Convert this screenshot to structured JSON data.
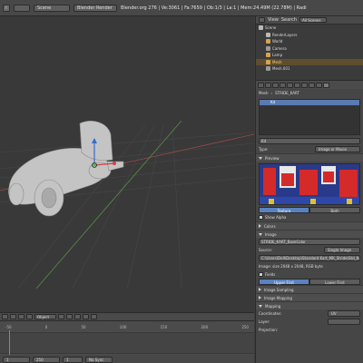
{
  "topbar": {
    "layout": "Scene",
    "render_engine": "Blender Render",
    "stats": "Blender.org 276 | Ve:3061 | Fa:7659 | Ob:1/3 | La:1 | Mem:24.49M (22.78M) | Radi"
  },
  "viewport": {
    "view_name": "",
    "mode": "Object",
    "colors": {
      "grid": "#4a4a4a",
      "axis_x": "#b04a4a",
      "axis_y": "#6aa050",
      "object": "#c9c9c9"
    }
  },
  "timeline": {
    "ruler": [
      "-50",
      "0",
      "50",
      "100",
      "150",
      "200",
      "250"
    ],
    "start": "1",
    "end": "250",
    "current": "1",
    "sync": "No Sync"
  },
  "outliner": {
    "view_label": "View",
    "search_label": "Search",
    "filter": "All Scenes",
    "items": [
      {
        "label": "Scene",
        "indent": 0,
        "color": "#b9b9b9"
      },
      {
        "label": "RenderLayers",
        "indent": 1,
        "color": "#b9b9b9"
      },
      {
        "label": "World",
        "indent": 1,
        "color": "#d6a34d"
      },
      {
        "label": "Camera",
        "indent": 1,
        "color": "#9a9a9a"
      },
      {
        "label": "Lamp",
        "indent": 1,
        "color": "#d6a34d"
      },
      {
        "label": "Mesh",
        "indent": 1,
        "color": "#d6a34d",
        "selected": true
      },
      {
        "label": "Mesh.001",
        "indent": 1,
        "color": "#9a9a9a"
      }
    ]
  },
  "properties": {
    "breadcrumb": [
      "Mesh",
      "STRIDE_KART"
    ],
    "slot_selected": "Kd",
    "texture_name": "Kd",
    "type_label": "Type:",
    "type_value": "Image or Movie",
    "preview_label": "Preview",
    "tabs": [
      "Texture",
      "Both"
    ],
    "show_alpha": "Show Alpha",
    "colors_label": "Colors",
    "image_label": "Image",
    "image_name": "STRIDE_KART_BaseColor",
    "source_label": "Source:",
    "source_value": "Single Image",
    "filepath": "C:\\Users\\Dell\\Desktop\\Standard Kart_MK_Stride\\Std_Kr",
    "image_info": "Image: size 2048 x 2048, RGB byte",
    "fields_label": "Fields",
    "field_tabs": [
      "Upper First",
      "Lower First"
    ],
    "image_sampling": "Image Sampling",
    "image_mapping": "Image Mapping",
    "mapping": "Mapping",
    "coordinates_label": "Coordinates:",
    "coordinates_value": "UV",
    "layer_label": "Layer:",
    "projection_label": "Projection:"
  }
}
